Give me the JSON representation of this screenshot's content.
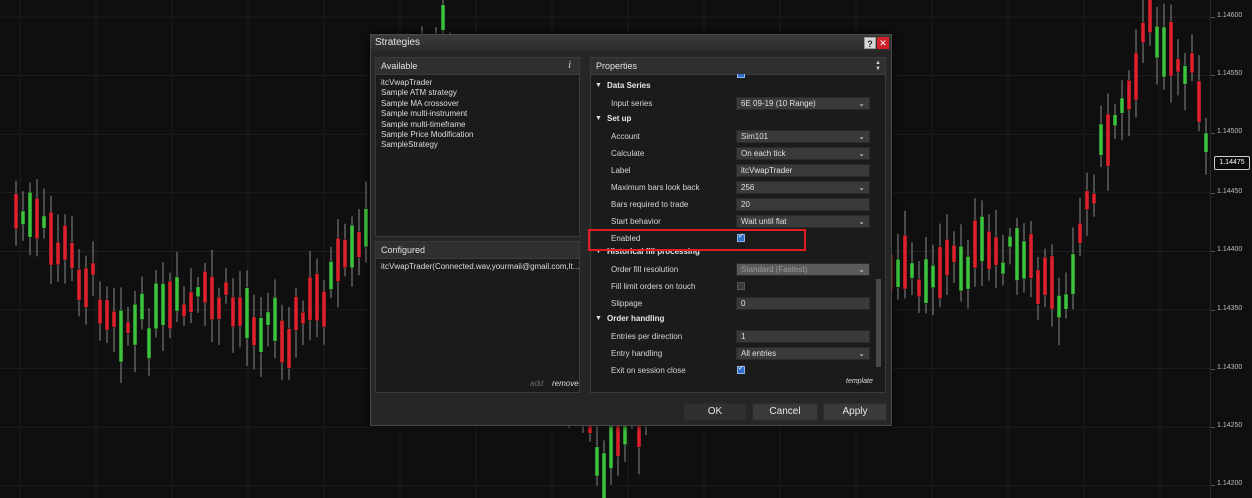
{
  "dialog": {
    "title": "Strategies",
    "help_label": "?",
    "close_label": "✕",
    "available_header": "Available",
    "info_icon": "i",
    "strategies": [
      "itcVwapTrader",
      "Sample ATM strategy",
      "Sample MA crossover",
      "Sample multi-instrument",
      "Sample multi-timeframe",
      "Sample Price Modification",
      "SampleStrategy"
    ],
    "configured_header": "Configured",
    "configured_item": "itcVwapTrader(Connected.wav,yourmail@gmail.com,lt...",
    "add_label": "add",
    "remove_label": "remove",
    "properties_header": "Properties",
    "template_label": "template",
    "ok_label": "OK",
    "cancel_label": "Cancel",
    "apply_label": "Apply",
    "properties": {
      "data_series": {
        "title": "Data Series",
        "input_series_label": "Input series",
        "input_series_value": "6E 09-19 (10 Range)"
      },
      "setup": {
        "title": "Set up",
        "account_label": "Account",
        "account_value": "Sim101",
        "calculate_label": "Calculate",
        "calculate_value": "On each tick",
        "label_label": "Label",
        "label_value": "itcVwapTrader",
        "max_bars_label": "Maximum bars look back",
        "max_bars_value": "256",
        "bars_required_label": "Bars required to trade",
        "bars_required_value": "20",
        "start_behavior_label": "Start behavior",
        "start_behavior_value": "Wait until flat",
        "enabled_label": "Enabled",
        "enabled": true
      },
      "historical": {
        "title": "Historical fill processing",
        "order_fill_label": "Order fill resolution",
        "order_fill_value": "Standard (Fastest)",
        "fill_limit_label": "Fill limit orders on touch",
        "fill_limit": false,
        "slippage_label": "Slippage",
        "slippage_value": "0"
      },
      "order_handling": {
        "title": "Order handling",
        "entries_label": "Entries per direction",
        "entries_value": "1",
        "entry_handling_label": "Entry handling",
        "entry_handling_value": "All entries",
        "exit_session_label": "Exit on session close",
        "exit_session": true
      }
    }
  },
  "price_axis": {
    "ticks": [
      "1.14600",
      "1.14550",
      "1.14500",
      "1.14450",
      "1.14400",
      "1.14350",
      "1.14300",
      "1.14250",
      "1.14200"
    ],
    "last_price": "1.14475"
  },
  "colors": {
    "bull": "#3cc43c",
    "bear": "#e0202a",
    "highlight": "#e01b24",
    "checkbox": "#2f6fc7"
  },
  "icons": {
    "help": "question-icon",
    "close": "close-icon",
    "info": "info-icon",
    "dropdown": "chevron-down-icon"
  }
}
